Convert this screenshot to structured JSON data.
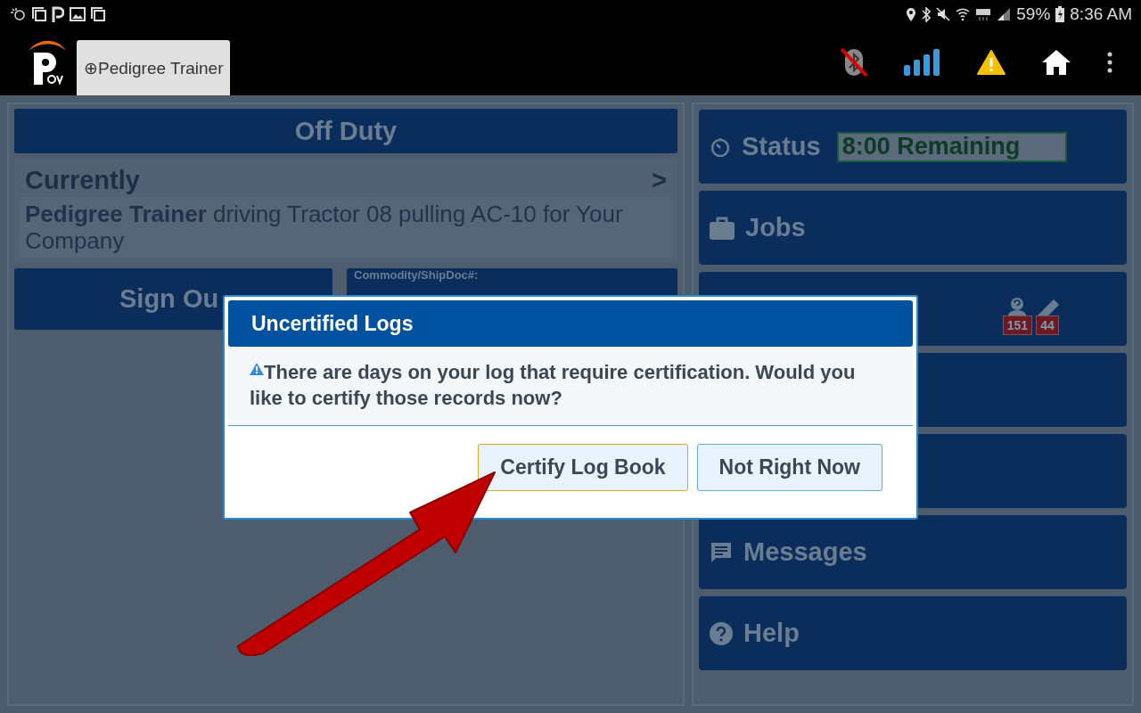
{
  "status_bar": {
    "battery": "59%",
    "time": "8:36 AM"
  },
  "app_bar": {
    "tab": {
      "label": "⊕Pedigree Trainer",
      "selected": true
    }
  },
  "left_panel": {
    "duty_status": "Off Duty",
    "currently": {
      "heading": "Currently",
      "chevron": ">",
      "driver": "Pedigree Trainer",
      "details": "driving Tractor 08 pulling AC-10 for Your Company"
    },
    "sign_out": "Sign Ou",
    "commodity_label": "Commodity/ShipDoc#:"
  },
  "right_tiles": [
    {
      "kind": "status",
      "label": "Status",
      "value": "8:00 Remaining"
    },
    {
      "kind": "jobs",
      "label": "Jobs"
    },
    {
      "kind": "badges",
      "badges": [
        "151",
        "44"
      ]
    },
    {
      "kind": "blank"
    },
    {
      "kind": "blank"
    },
    {
      "kind": "messages",
      "label": "Messages"
    },
    {
      "kind": "help",
      "label": "Help"
    }
  ],
  "dialog": {
    "title": "Uncertified Logs",
    "message": "There are days on your log that require certification. Would you like to certify those records now?",
    "buttons": [
      {
        "label": "Certify Log Book",
        "focused": true
      },
      {
        "label": "Not Right Now",
        "focused": false
      }
    ]
  }
}
